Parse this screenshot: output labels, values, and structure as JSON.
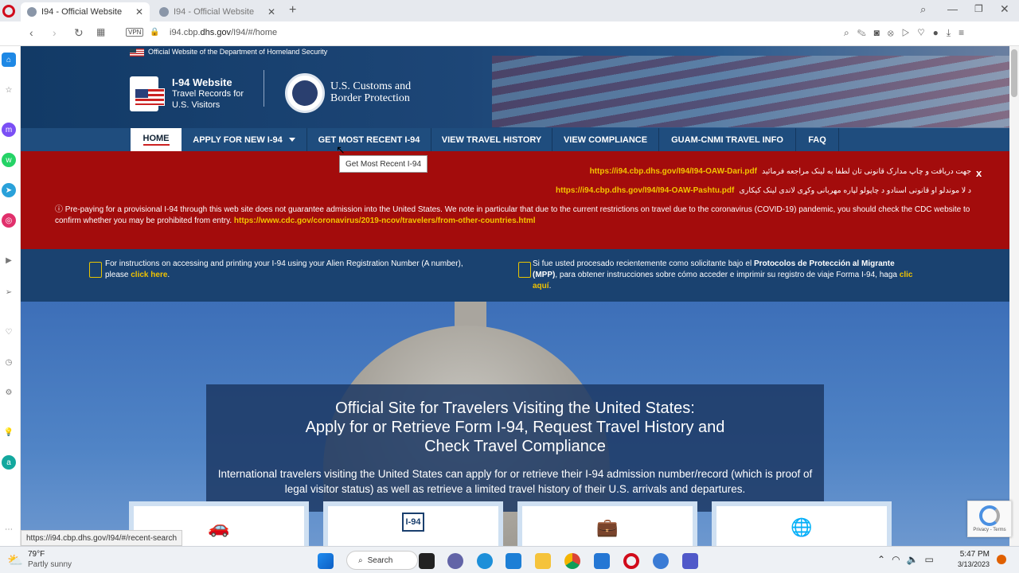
{
  "browser": {
    "tabs": [
      {
        "title": "I94 - Official Website"
      },
      {
        "title": "I94 - Official Website"
      }
    ],
    "url_prefix": "i94.cbp.",
    "url_domain": "dhs.gov",
    "url_path": "/I94/#/home",
    "vpn_label": "VPN",
    "status_url": "https://i94.cbp.dhs.gov/I94/#/recent-search"
  },
  "site": {
    "official_banner": "Official Website of the Department of Homeland Security",
    "logo_title": "I-94 Website",
    "logo_sub1": "Travel Records for",
    "logo_sub2": "U.S. Visitors",
    "agency_line1": "U.S. Customs and",
    "agency_line2": "Border Protection",
    "nav": [
      {
        "label": "HOME"
      },
      {
        "label": "APPLY FOR NEW I-94"
      },
      {
        "label": "GET MOST RECENT I-94"
      },
      {
        "label": "VIEW TRAVEL HISTORY"
      },
      {
        "label": "VIEW COMPLIANCE"
      },
      {
        "label": "GUAM-CNMI TRAVEL INFO"
      },
      {
        "label": "FAQ"
      }
    ],
    "tooltip": "Get Most Recent I-94",
    "alert": {
      "dari_text": "جهت دریافت و چاپ مدارک قانونی تان لطفا به لینک مراجعه فرمائید",
      "dari_link": "https://i94.cbp.dhs.gov/I94/I94-OAW-Dari.pdf",
      "pashtu_text": "د لا موندلو او قانونی اسنادو د چاپولو لپاره مهربانی وکړی لاندی لینک کیکاری",
      "pashtu_link": "https://i94.cbp.dhs.gov/I94/I94-OAW-Pashtu.pdf",
      "close": "x",
      "message": "Pre-paying for a provisional I-94 through this web site does not guarantee admission into the United States. We note in particular that due to the current restrictions on travel due to the coronavirus (COVID-19) pandemic, you should check the CDC website to confirm whether you may be prohibited from entry.",
      "cdc_link": "https://www.cdc.gov/coronavirus/2019-ncov/travelers/from-other-countries.html"
    },
    "info_en": {
      "text": "For instructions on accessing and printing your I-94 using your Alien Registration Number (A number), please",
      "link": "click here"
    },
    "info_es": {
      "text_a": "Si fue usted procesado recientemente como solicitante bajo el",
      "bold": "Protocolos de Protección al Migrante (MPP)",
      "text_b": ", para obtener instrucciones sobre cómo acceder e imprimir su registro de viaje Forma I-94, haga",
      "link": "clic aquí"
    },
    "hero": {
      "title_line1": "Official Site for Travelers Visiting the United States:",
      "title_line2": "Apply for or Retrieve Form I-94, Request Travel History and",
      "title_line3": "Check Travel Compliance",
      "body": "International travelers visiting the United States can apply for or retrieve their I-94 admission number/record (which is proof of legal visitor status) as well as retrieve a limited travel history of their U.S. arrivals and departures."
    },
    "card_i94_label": "I-94"
  },
  "recaptcha": {
    "text": "Privacy - Terms"
  },
  "taskbar": {
    "weather_temp": "79°F",
    "weather_desc": "Partly sunny",
    "search_label": "Search",
    "time": "5:47 PM",
    "date": "3/13/2023"
  }
}
